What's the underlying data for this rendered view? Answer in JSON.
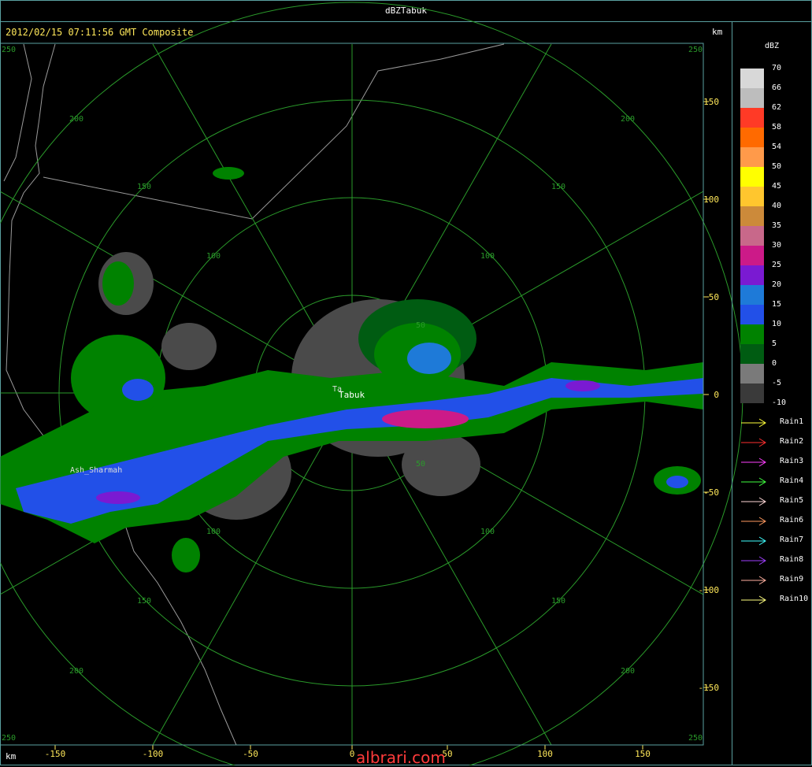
{
  "title": "dBZTabuk",
  "timestamp": "2012/02/15 07:11:56 GMT Composite",
  "unit_km": "km",
  "legend": {
    "unit": "dBZ",
    "items": [
      {
        "label": "70",
        "color": "#d8d8d8"
      },
      {
        "label": "66",
        "color": "#bdbdbd"
      },
      {
        "label": "62",
        "color": "#ff3a26"
      },
      {
        "label": "58",
        "color": "#ff6a00"
      },
      {
        "label": "54",
        "color": "#ff9a4a"
      },
      {
        "label": "50",
        "color": "#ffff00"
      },
      {
        "label": "45",
        "color": "#ffc62e"
      },
      {
        "label": "40",
        "color": "#cc8a3a"
      },
      {
        "label": "35",
        "color": "#c8688a"
      },
      {
        "label": "30",
        "color": "#cc1a88"
      },
      {
        "label": "25",
        "color": "#7a1ad2"
      },
      {
        "label": "20",
        "color": "#1e7ad8"
      },
      {
        "label": "15",
        "color": "#2250e8"
      },
      {
        "label": "10",
        "color": "#008200"
      },
      {
        "label": "5",
        "color": "#005c12"
      },
      {
        "label": "0",
        "color": "#7a7a7a"
      },
      {
        "label": "-5",
        "color": "#3a3a3a"
      },
      {
        "label": "-10",
        "color": ""
      }
    ],
    "rain": [
      {
        "label": "Rain1",
        "color": "#ffff3a"
      },
      {
        "label": "Rain2",
        "color": "#ff3030"
      },
      {
        "label": "Rain3",
        "color": "#ff40ff"
      },
      {
        "label": "Rain4",
        "color": "#40ff40"
      },
      {
        "label": "Rain5",
        "color": "#ffd8d8"
      },
      {
        "label": "Rain6",
        "color": "#ff9a60"
      },
      {
        "label": "Rain7",
        "color": "#40ffff"
      },
      {
        "label": "Rain8",
        "color": "#a040ff"
      },
      {
        "label": "Rain9",
        "color": "#ffb0a0"
      },
      {
        "label": "Rain10",
        "color": "#ffff80"
      }
    ]
  },
  "map": {
    "station": "Tabuk",
    "station_prefix": "Ta",
    "city": "Ash_Sharmah",
    "ring_labels": [
      "50",
      "100",
      "150",
      "200",
      "250"
    ],
    "x_ticks": [
      "-150",
      "-100",
      "-50",
      "0",
      "50",
      "100",
      "150"
    ],
    "y_ticks": [
      "150",
      "100",
      "50",
      "0",
      "-50",
      "-100",
      "-150"
    ]
  },
  "watermark": "albrari.com"
}
